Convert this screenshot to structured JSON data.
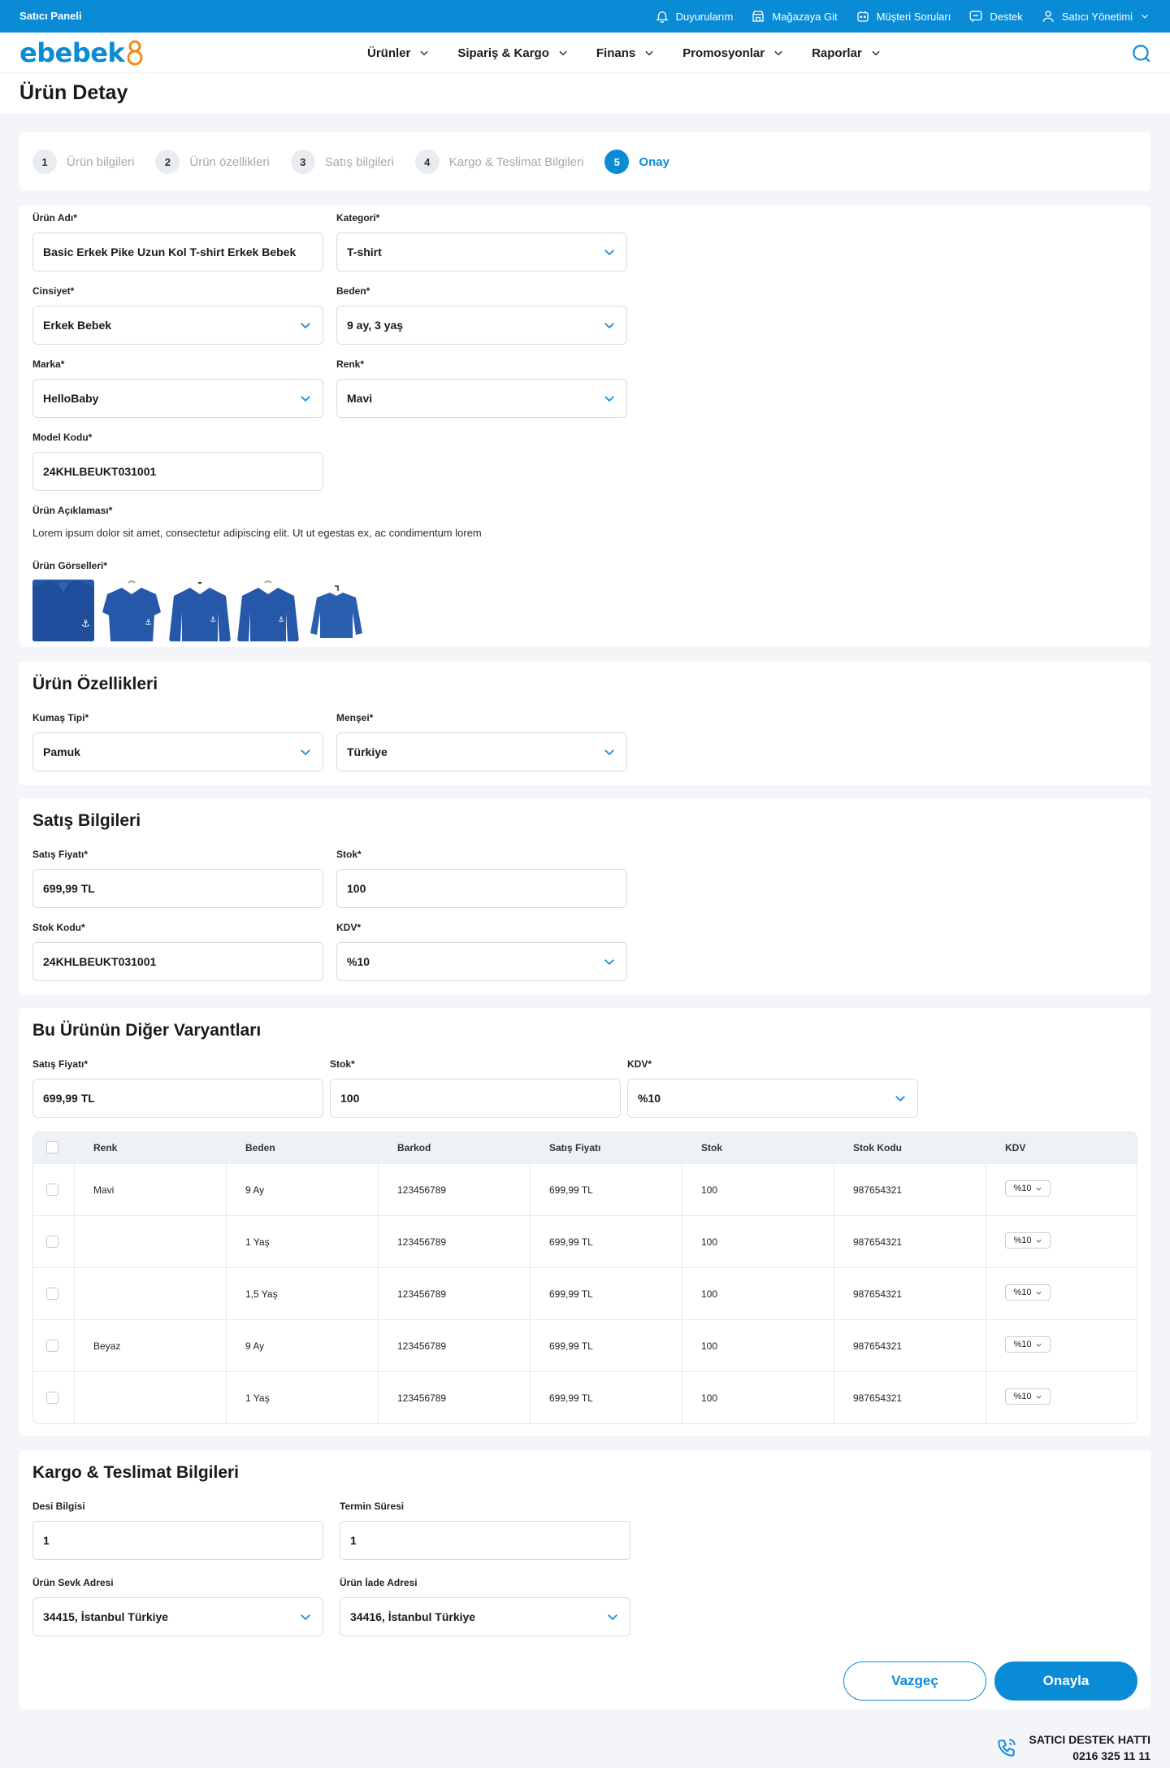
{
  "topbar": {
    "title": "Satıcı Paneli",
    "links": [
      {
        "label": "Duyurularım",
        "icon": "bell-icon"
      },
      {
        "label": "Mağazaya Git",
        "icon": "store-icon"
      },
      {
        "label": "Müşteri Soruları",
        "icon": "question-bubble-icon"
      },
      {
        "label": "Destek",
        "icon": "chat-icon"
      },
      {
        "label": "Satıcı Yönetimi",
        "icon": "user-icon"
      }
    ]
  },
  "brand": {
    "logo_text": "ebebek",
    "color": "#0a8bd6"
  },
  "nav": {
    "items": [
      "Ürünler",
      "Sipariş & Kargo",
      "Finans",
      "Promosyonlar",
      "Raporlar"
    ]
  },
  "page": {
    "title": "Ürün Detay"
  },
  "stepper": {
    "steps": [
      {
        "num": "1",
        "label": "Ürün bilgileri"
      },
      {
        "num": "2",
        "label": "Ürün özellikleri"
      },
      {
        "num": "3",
        "label": "Satış bilgileri"
      },
      {
        "num": "4",
        "label": "Kargo & Teslimat Bilgileri"
      },
      {
        "num": "5",
        "label": "Onay"
      }
    ],
    "active": 5
  },
  "product": {
    "name_label": "Ürün Adı*",
    "name": "Basic Erkek Pike Uzun Kol T-shirt Erkek Bebek",
    "category_label": "Kategori*",
    "category": "T-shirt",
    "gender_label": "Cinsiyet*",
    "gender": "Erkek Bebek",
    "size_label": "Beden*",
    "size": "9 ay, 3 yaş",
    "brand_label": "Marka*",
    "brand": "HelloBaby",
    "color_label": "Renk*",
    "color": "Mavi",
    "model_label": "Model Kodu*",
    "model": "24KHLBEUKT031001",
    "desc_label": "Ürün Açıklaması*",
    "desc": "Lorem ipsum dolor sit amet, consectetur adipiscing elit. Ut ut egestas ex, ac condimentum lorem",
    "images_label": "Ürün Görselleri*"
  },
  "features": {
    "title": "Ürün Özellikleri",
    "fabric_label": "Kumaş Tipi*",
    "fabric": "Pamuk",
    "origin_label": "Menşei*",
    "origin": "Türkiye"
  },
  "sales": {
    "title": "Satış Bilgileri",
    "price_label": "Satış Fiyatı*",
    "price": "699,99 TL",
    "stock_label": "Stok*",
    "stock": "100",
    "sku_label": "Stok Kodu*",
    "sku": "24KHLBEUKT031001",
    "vat_label": "KDV*",
    "vat": "%10"
  },
  "variants": {
    "title": "Bu Ürünün Diğer Varyantları",
    "price_label": "Satış Fiyatı*",
    "price": "699,99 TL",
    "stock_label": "Stok*",
    "stock": "100",
    "vat_label": "KDV*",
    "vat": "%10",
    "columns": [
      "Renk",
      "Beden",
      "Barkod",
      "Satış Fiyatı",
      "Stok",
      "Stok Kodu",
      "KDV"
    ],
    "rows": [
      {
        "color": "Mavi",
        "size": "9 Ay",
        "barcode": "123456789",
        "price": "699,99 TL",
        "stock": "100",
        "sku": "987654321",
        "vat": "%10"
      },
      {
        "color": "",
        "size": "1 Yaş",
        "barcode": "123456789",
        "price": "699,99 TL",
        "stock": "100",
        "sku": "987654321",
        "vat": "%10"
      },
      {
        "color": "",
        "size": "1,5 Yaş",
        "barcode": "123456789",
        "price": "699,99 TL",
        "stock": "100",
        "sku": "987654321",
        "vat": "%10"
      },
      {
        "color": "Beyaz",
        "size": "9 Ay",
        "barcode": "123456789",
        "price": "699,99 TL",
        "stock": "100",
        "sku": "987654321",
        "vat": "%10"
      },
      {
        "color": "",
        "size": "1 Yaş",
        "barcode": "123456789",
        "price": "699,99 TL",
        "stock": "100",
        "sku": "987654321",
        "vat": "%10"
      }
    ]
  },
  "shipping": {
    "title": "Kargo & Teslimat Bilgileri",
    "desi_label": "Desi Bilgisi",
    "desi": "1",
    "term_label": "Termin Süresi",
    "term": "1",
    "ship_addr_label": "Ürün Sevk Adresi",
    "ship_addr": "34415, İstanbul Türkiye",
    "return_addr_label": "Ürün İade Adresi",
    "return_addr": "34416, İstanbul Türkiye"
  },
  "actions": {
    "cancel": "Vazgeç",
    "confirm": "Onayla"
  },
  "support": {
    "line1": "SATICI DESTEK HATTI",
    "line2": "0216 325 11 11"
  }
}
